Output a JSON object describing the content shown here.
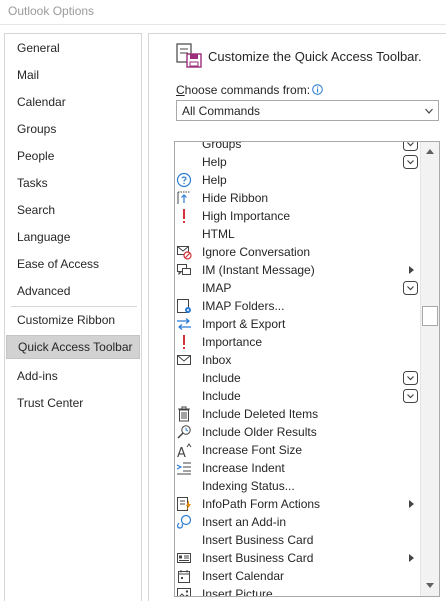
{
  "window": {
    "title": "Outlook Options"
  },
  "sidebar": {
    "items": [
      {
        "label": "General"
      },
      {
        "label": "Mail"
      },
      {
        "label": "Calendar"
      },
      {
        "label": "Groups"
      },
      {
        "label": "People"
      },
      {
        "label": "Tasks"
      },
      {
        "label": "Search"
      },
      {
        "label": "Language"
      },
      {
        "label": "Ease of Access"
      },
      {
        "label": "Advanced"
      },
      {
        "label": "Customize Ribbon"
      },
      {
        "label": "Quick Access Toolbar"
      },
      {
        "label": "Add-ins"
      },
      {
        "label": "Trust Center"
      }
    ],
    "selected": "Quick Access Toolbar"
  },
  "main": {
    "header": "Customize the Quick Access Toolbar.",
    "choose_label_underlined": "C",
    "choose_label_rest": "hoose commands from:",
    "commands_dropdown_value": "All Commands",
    "commands": [
      {
        "label": "Groups",
        "icon": "none",
        "dropdown": true,
        "submenu": false
      },
      {
        "label": "Help",
        "icon": "none",
        "dropdown": true,
        "submenu": false
      },
      {
        "label": "Help",
        "icon": "help-icon",
        "dropdown": false,
        "submenu": false
      },
      {
        "label": "Hide Ribbon",
        "icon": "hide-ribbon-icon",
        "dropdown": false,
        "submenu": false
      },
      {
        "label": "High Importance",
        "icon": "high-importance-icon",
        "dropdown": false,
        "submenu": false
      },
      {
        "label": "HTML",
        "icon": "none",
        "dropdown": false,
        "submenu": false
      },
      {
        "label": "Ignore Conversation",
        "icon": "ignore-conversation-icon",
        "dropdown": false,
        "submenu": false
      },
      {
        "label": "IM (Instant Message)",
        "icon": "instant-message-icon",
        "dropdown": false,
        "submenu": true
      },
      {
        "label": "IMAP",
        "icon": "none",
        "dropdown": true,
        "submenu": false
      },
      {
        "label": "IMAP Folders...",
        "icon": "imap-folders-icon",
        "dropdown": false,
        "submenu": false
      },
      {
        "label": "Import & Export",
        "icon": "import-export-icon",
        "dropdown": false,
        "submenu": false
      },
      {
        "label": "Importance",
        "icon": "importance-icon",
        "dropdown": false,
        "submenu": false
      },
      {
        "label": "Inbox",
        "icon": "inbox-icon",
        "dropdown": false,
        "submenu": false
      },
      {
        "label": "Include",
        "icon": "none",
        "dropdown": true,
        "submenu": false
      },
      {
        "label": "Include",
        "icon": "none",
        "dropdown": true,
        "submenu": false
      },
      {
        "label": "Include Deleted Items",
        "icon": "deleted-items-icon",
        "dropdown": false,
        "submenu": false
      },
      {
        "label": "Include Older Results",
        "icon": "older-results-icon",
        "dropdown": false,
        "submenu": false
      },
      {
        "label": "Increase Font Size",
        "icon": "increase-font-size-icon",
        "dropdown": false,
        "submenu": false
      },
      {
        "label": "Increase Indent",
        "icon": "increase-indent-icon",
        "dropdown": false,
        "submenu": false
      },
      {
        "label": "Indexing Status...",
        "icon": "none",
        "dropdown": false,
        "submenu": false
      },
      {
        "label": "InfoPath Form Actions",
        "icon": "infopath-icon",
        "dropdown": false,
        "submenu": true
      },
      {
        "label": "Insert an Add-in",
        "icon": "add-in-icon",
        "dropdown": false,
        "submenu": false
      },
      {
        "label": "Insert Business Card",
        "icon": "none",
        "dropdown": false,
        "submenu": false
      },
      {
        "label": "Insert Business Card",
        "icon": "business-card-icon",
        "dropdown": false,
        "submenu": true
      },
      {
        "label": "Insert Calendar",
        "icon": "calendar-icon",
        "dropdown": false,
        "submenu": false
      },
      {
        "label": "Insert Picture",
        "icon": "picture-icon",
        "dropdown": false,
        "submenu": false
      }
    ]
  }
}
